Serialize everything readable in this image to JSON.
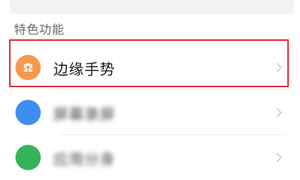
{
  "section": {
    "title": "特色功能"
  },
  "rows": [
    {
      "label": "边缘手势",
      "icon": "edge-gesture-icon",
      "icon_color": "#f59a4c",
      "highlighted": true
    },
    {
      "label": "屏幕录屏",
      "icon": "screen-record-icon",
      "icon_color": "#3d8ef0",
      "blurred": true
    },
    {
      "label": "应用分身",
      "icon": "app-clone-icon",
      "icon_color": "#35b35a",
      "blurred": true
    }
  ],
  "colors": {
    "highlight_border": "#e0262e",
    "section_title": "#666666",
    "chevron": "#c4c4c4"
  }
}
